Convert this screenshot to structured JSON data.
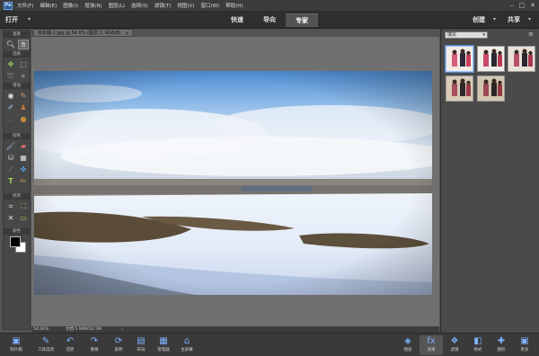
{
  "menubar": {
    "logo": "Pe",
    "items": [
      "文件(F)",
      "编辑(E)",
      "图像(I)",
      "增强(N)",
      "图层(L)",
      "选择(S)",
      "滤镜(T)",
      "视图(V)",
      "窗口(W)",
      "帮助(H)"
    ],
    "window_controls": [
      "–",
      "□",
      "✕"
    ]
  },
  "modebar": {
    "open_label": "打开",
    "modes": [
      "快速",
      "导向",
      "专家"
    ],
    "active_mode": "专家",
    "create_label": "创建",
    "share_label": "共享"
  },
  "toolbox": {
    "sections": [
      "查看",
      "选择",
      "增强",
      "绘制",
      "修改",
      "颜色"
    ]
  },
  "document": {
    "tab_title": "未标题-1.jpg @ 54.0% (图层 1, RGB/8)",
    "close_glyph": "×"
  },
  "status": {
    "zoom": "54.04%",
    "doc_size": "文档:5.99M/10.5M",
    "arrow": "›"
  },
  "right_panel": {
    "category": "填充",
    "thumbnail_count": 5
  },
  "bottombar": {
    "left_buttons": [
      {
        "label": "照片箱",
        "icon": "photo-bin-icon"
      },
      {
        "label": "工具选项",
        "icon": "tool-options-icon"
      },
      {
        "label": "还原",
        "icon": "undo-icon"
      },
      {
        "label": "重做",
        "icon": "redo-icon"
      },
      {
        "label": "旋转",
        "icon": "rotate-icon"
      },
      {
        "label": "布局",
        "icon": "layout-icon"
      },
      {
        "label": "管理器",
        "icon": "organizer-icon"
      },
      {
        "label": "主屏幕",
        "icon": "home-icon"
      }
    ],
    "right_buttons": [
      {
        "label": "图层",
        "icon": "layers-icon"
      },
      {
        "label": "效果",
        "icon": "effects-icon"
      },
      {
        "label": "滤镜",
        "icon": "filters-icon"
      },
      {
        "label": "样式",
        "icon": "styles-icon"
      },
      {
        "label": "图形",
        "icon": "graphics-icon"
      },
      {
        "label": "更多",
        "icon": "more-icon"
      }
    ],
    "active_right": "效果"
  }
}
